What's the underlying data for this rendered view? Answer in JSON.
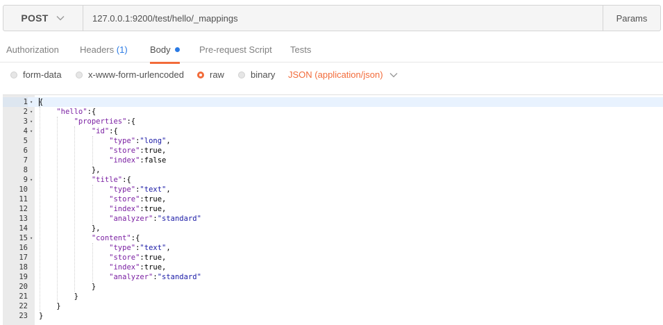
{
  "request": {
    "method": "POST",
    "url": "127.0.0.1:9200/test/hello/_mappings",
    "params_label": "Params"
  },
  "tabs": [
    {
      "label": "Authorization"
    },
    {
      "label": "Headers",
      "count": "(1)"
    },
    {
      "label": "Body"
    },
    {
      "label": "Pre-request Script"
    },
    {
      "label": "Tests"
    }
  ],
  "active_tab": "Body",
  "body_modes": [
    {
      "label": "form-data",
      "checked": false
    },
    {
      "label": "x-www-form-urlencoded",
      "checked": false
    },
    {
      "label": "raw",
      "checked": true
    },
    {
      "label": "binary",
      "checked": false
    }
  ],
  "content_type": "JSON (application/json)",
  "colors": {
    "accent": "#f26b3a",
    "link": "#2a7ae4",
    "json_key": "#7a1fa2",
    "json_string": "#1a1aa6"
  },
  "editor": {
    "lines": [
      {
        "n": "1",
        "fold": true,
        "indent": 0,
        "tokens": [
          [
            "p",
            "{"
          ]
        ]
      },
      {
        "n": "2",
        "fold": true,
        "indent": 1,
        "tokens": [
          [
            "k",
            "\"hello\""
          ],
          [
            "p",
            ":{"
          ]
        ]
      },
      {
        "n": "3",
        "fold": true,
        "indent": 2,
        "tokens": [
          [
            "k",
            "\"properties\""
          ],
          [
            "p",
            ":{"
          ]
        ]
      },
      {
        "n": "4",
        "fold": true,
        "indent": 3,
        "tokens": [
          [
            "k",
            "\"id\""
          ],
          [
            "p",
            ":{"
          ]
        ]
      },
      {
        "n": "5",
        "fold": false,
        "indent": 4,
        "tokens": [
          [
            "k",
            "\"type\""
          ],
          [
            "p",
            ":"
          ],
          [
            "s",
            "\"long\""
          ],
          [
            "p",
            ","
          ]
        ]
      },
      {
        "n": "6",
        "fold": false,
        "indent": 4,
        "tokens": [
          [
            "k",
            "\"store\""
          ],
          [
            "p",
            ":true,"
          ]
        ]
      },
      {
        "n": "7",
        "fold": false,
        "indent": 4,
        "tokens": [
          [
            "k",
            "\"index\""
          ],
          [
            "p",
            ":false"
          ]
        ]
      },
      {
        "n": "8",
        "fold": false,
        "indent": 3,
        "tokens": [
          [
            "p",
            "},"
          ]
        ]
      },
      {
        "n": "9",
        "fold": true,
        "indent": 3,
        "tokens": [
          [
            "k",
            "\"title\""
          ],
          [
            "p",
            ":{"
          ]
        ]
      },
      {
        "n": "10",
        "fold": false,
        "indent": 4,
        "tokens": [
          [
            "k",
            "\"type\""
          ],
          [
            "p",
            ":"
          ],
          [
            "s",
            "\"text\""
          ],
          [
            "p",
            ","
          ]
        ]
      },
      {
        "n": "11",
        "fold": false,
        "indent": 4,
        "tokens": [
          [
            "k",
            "\"store\""
          ],
          [
            "p",
            ":true,"
          ]
        ]
      },
      {
        "n": "12",
        "fold": false,
        "indent": 4,
        "tokens": [
          [
            "k",
            "\"index\""
          ],
          [
            "p",
            ":true,"
          ]
        ]
      },
      {
        "n": "13",
        "fold": false,
        "indent": 4,
        "tokens": [
          [
            "k",
            "\"analyzer\""
          ],
          [
            "p",
            ":"
          ],
          [
            "s",
            "\"standard\""
          ]
        ]
      },
      {
        "n": "14",
        "fold": false,
        "indent": 3,
        "tokens": [
          [
            "p",
            "},"
          ]
        ]
      },
      {
        "n": "15",
        "fold": true,
        "indent": 3,
        "tokens": [
          [
            "k",
            "\"content\""
          ],
          [
            "p",
            ":{"
          ]
        ]
      },
      {
        "n": "16",
        "fold": false,
        "indent": 4,
        "tokens": [
          [
            "k",
            "\"type\""
          ],
          [
            "p",
            ":"
          ],
          [
            "s",
            "\"text\""
          ],
          [
            "p",
            ","
          ]
        ]
      },
      {
        "n": "17",
        "fold": false,
        "indent": 4,
        "tokens": [
          [
            "k",
            "\"store\""
          ],
          [
            "p",
            ":true,"
          ]
        ]
      },
      {
        "n": "18",
        "fold": false,
        "indent": 4,
        "tokens": [
          [
            "k",
            "\"index\""
          ],
          [
            "p",
            ":true,"
          ]
        ]
      },
      {
        "n": "19",
        "fold": false,
        "indent": 4,
        "tokens": [
          [
            "k",
            "\"analyzer\""
          ],
          [
            "p",
            ":"
          ],
          [
            "s",
            "\"standard\""
          ]
        ]
      },
      {
        "n": "20",
        "fold": false,
        "indent": 3,
        "tokens": [
          [
            "p",
            "}"
          ]
        ]
      },
      {
        "n": "21",
        "fold": false,
        "indent": 2,
        "tokens": [
          [
            "p",
            "}"
          ]
        ]
      },
      {
        "n": "22",
        "fold": false,
        "indent": 1,
        "tokens": [
          [
            "p",
            "}"
          ]
        ]
      },
      {
        "n": "23",
        "fold": false,
        "indent": 0,
        "tokens": [
          [
            "p",
            "}"
          ]
        ]
      }
    ]
  }
}
